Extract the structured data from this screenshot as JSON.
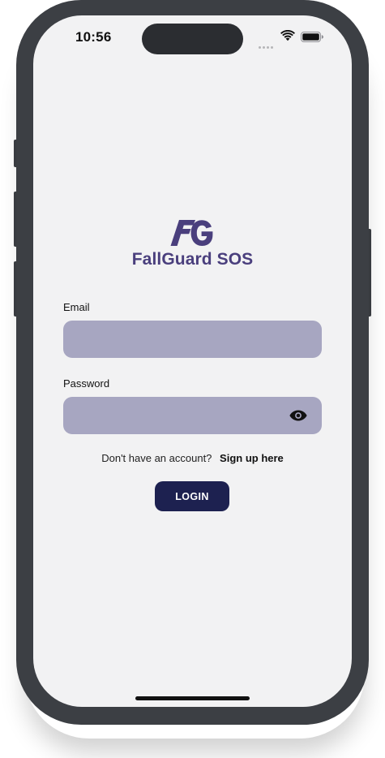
{
  "status_bar": {
    "time": "10:56"
  },
  "brand": {
    "logo_mark": "FG",
    "name": "FallGuard SOS",
    "color": "#4a3f7d"
  },
  "form": {
    "email": {
      "label": "Email",
      "value": "",
      "placeholder": ""
    },
    "password": {
      "label": "Password",
      "value": "",
      "placeholder": "",
      "toggle_icon": "eye-icon"
    }
  },
  "signup": {
    "prompt": "Don't have an account?",
    "link": "Sign up here"
  },
  "login_button": {
    "label": "LOGIN",
    "color": "#1d2150"
  },
  "colors": {
    "input_fill": "#a7a6c1",
    "screen_bg": "#f2f2f3",
    "frame": "#3c3f44"
  }
}
